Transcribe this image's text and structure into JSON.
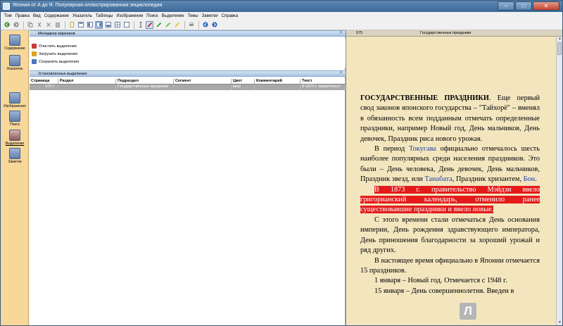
{
  "window": {
    "title": "Япония от А до Я. Популярная иллюстрированная энциклопедия",
    "controls": {
      "minimize": "–",
      "maximize": "□",
      "close": "✕"
    }
  },
  "menu": [
    "Том",
    "Правка",
    "Вид",
    "Содержание",
    "Указатель",
    "Таблицы",
    "Изображения",
    "Поиск",
    "Выделение",
    "Темы",
    "Заметки",
    "Справка"
  ],
  "toolbar": {
    "icons": [
      "back-icon",
      "forward-icon",
      "copy-icon",
      "cut-icon",
      "delete-icon",
      "paste-icon",
      "page-icon",
      "layout-one-icon",
      "layout-two-icon",
      "layout-three-icon",
      "layout-four-icon",
      "layout-five-icon",
      "layout-six-icon",
      "text-cursor-icon",
      "red-marker-icon",
      "green-marker-icon",
      "green-marker-2-icon",
      "yellow-marker-icon",
      "print-icon",
      "nav-back-icon",
      "nav-forward-icon"
    ]
  },
  "sidebar": {
    "items": [
      {
        "label": "Содержание",
        "icon": "contents-icon"
      },
      {
        "label": "Указатель",
        "icon": "index-icon"
      },
      {
        "label": "Изображения",
        "icon": "images-icon"
      },
      {
        "label": "Поиск",
        "icon": "search-icon"
      },
      {
        "label": "Выделение",
        "icon": "highlight-icon"
      },
      {
        "label": "Заметки",
        "icon": "notes-icon"
      }
    ]
  },
  "marker_manager": {
    "title": "Менеджер маркеров",
    "actions": [
      {
        "label": "Очистить выделения",
        "icon": "clear-icon"
      },
      {
        "label": "Загрузить выделения",
        "icon": "load-icon"
      },
      {
        "label": "Сохранить выделения",
        "icon": "save-icon"
      }
    ]
  },
  "highlights": {
    "title": "Установленные выделения",
    "columns": [
      "Страница",
      "Раздел",
      "Подраздел",
      "Сегмент",
      "Цвет",
      "Комментарий",
      "Текст"
    ],
    "rows": [
      {
        "page": "575 Г",
        "section": "",
        "subsection": "Государственные праздники",
        "segment": "",
        "color": "крас",
        "comment": "",
        "text": "В 1873 г. правительст"
      }
    ]
  },
  "document": {
    "page_number": "575",
    "header_title": "Государственные праздники",
    "heading": "ГОСУДАРСТВЕННЫЕ ПРАЗДНИКИ",
    "p1_rest": ". Еще первый свод законов японского государства – \"Тайхорё\" – вменял в обязанность всем подданным отмечать определенные праздники, например Новый год, День мальчиков, День девочек, Праздник риса нового урожая.",
    "p2_a": "В период ",
    "p2_link1": "Токугава",
    "p2_b": " официально отмечалось шесть наиболее популярных среди населения праздников. Это были – День человека, День девочек, День мальчиков, Праздник звезд, или ",
    "p2_link2": "Танабата",
    "p2_c": ", Праздник хризантем, ",
    "p2_link3": "Бон",
    "p2_d": ".",
    "p3_highlight": "В 1873 г. правительство Мэйдзи ввело григорианский календарь, отменило ранее существовавшие праздники и ввело новые.",
    "p4": "С этого времени стали отмечаться День основания империи, День рождения здравствующего императора, День приношения благодарности за хороший урожай и ряд других.",
    "p5": "В настоящее время официально в Японии отмечается 15 праздников.",
    "p6": "1 января – Новый год. Отмечается с 1948 г.",
    "p7": "15 января – День совершеннолетия. Введен в"
  },
  "watermark": "Л",
  "colors": {
    "highlight": "#e31b1b",
    "link": "#1f3fa8",
    "page_bg": "#f3e6bf",
    "sidebar_bg": "#f7d79a"
  }
}
